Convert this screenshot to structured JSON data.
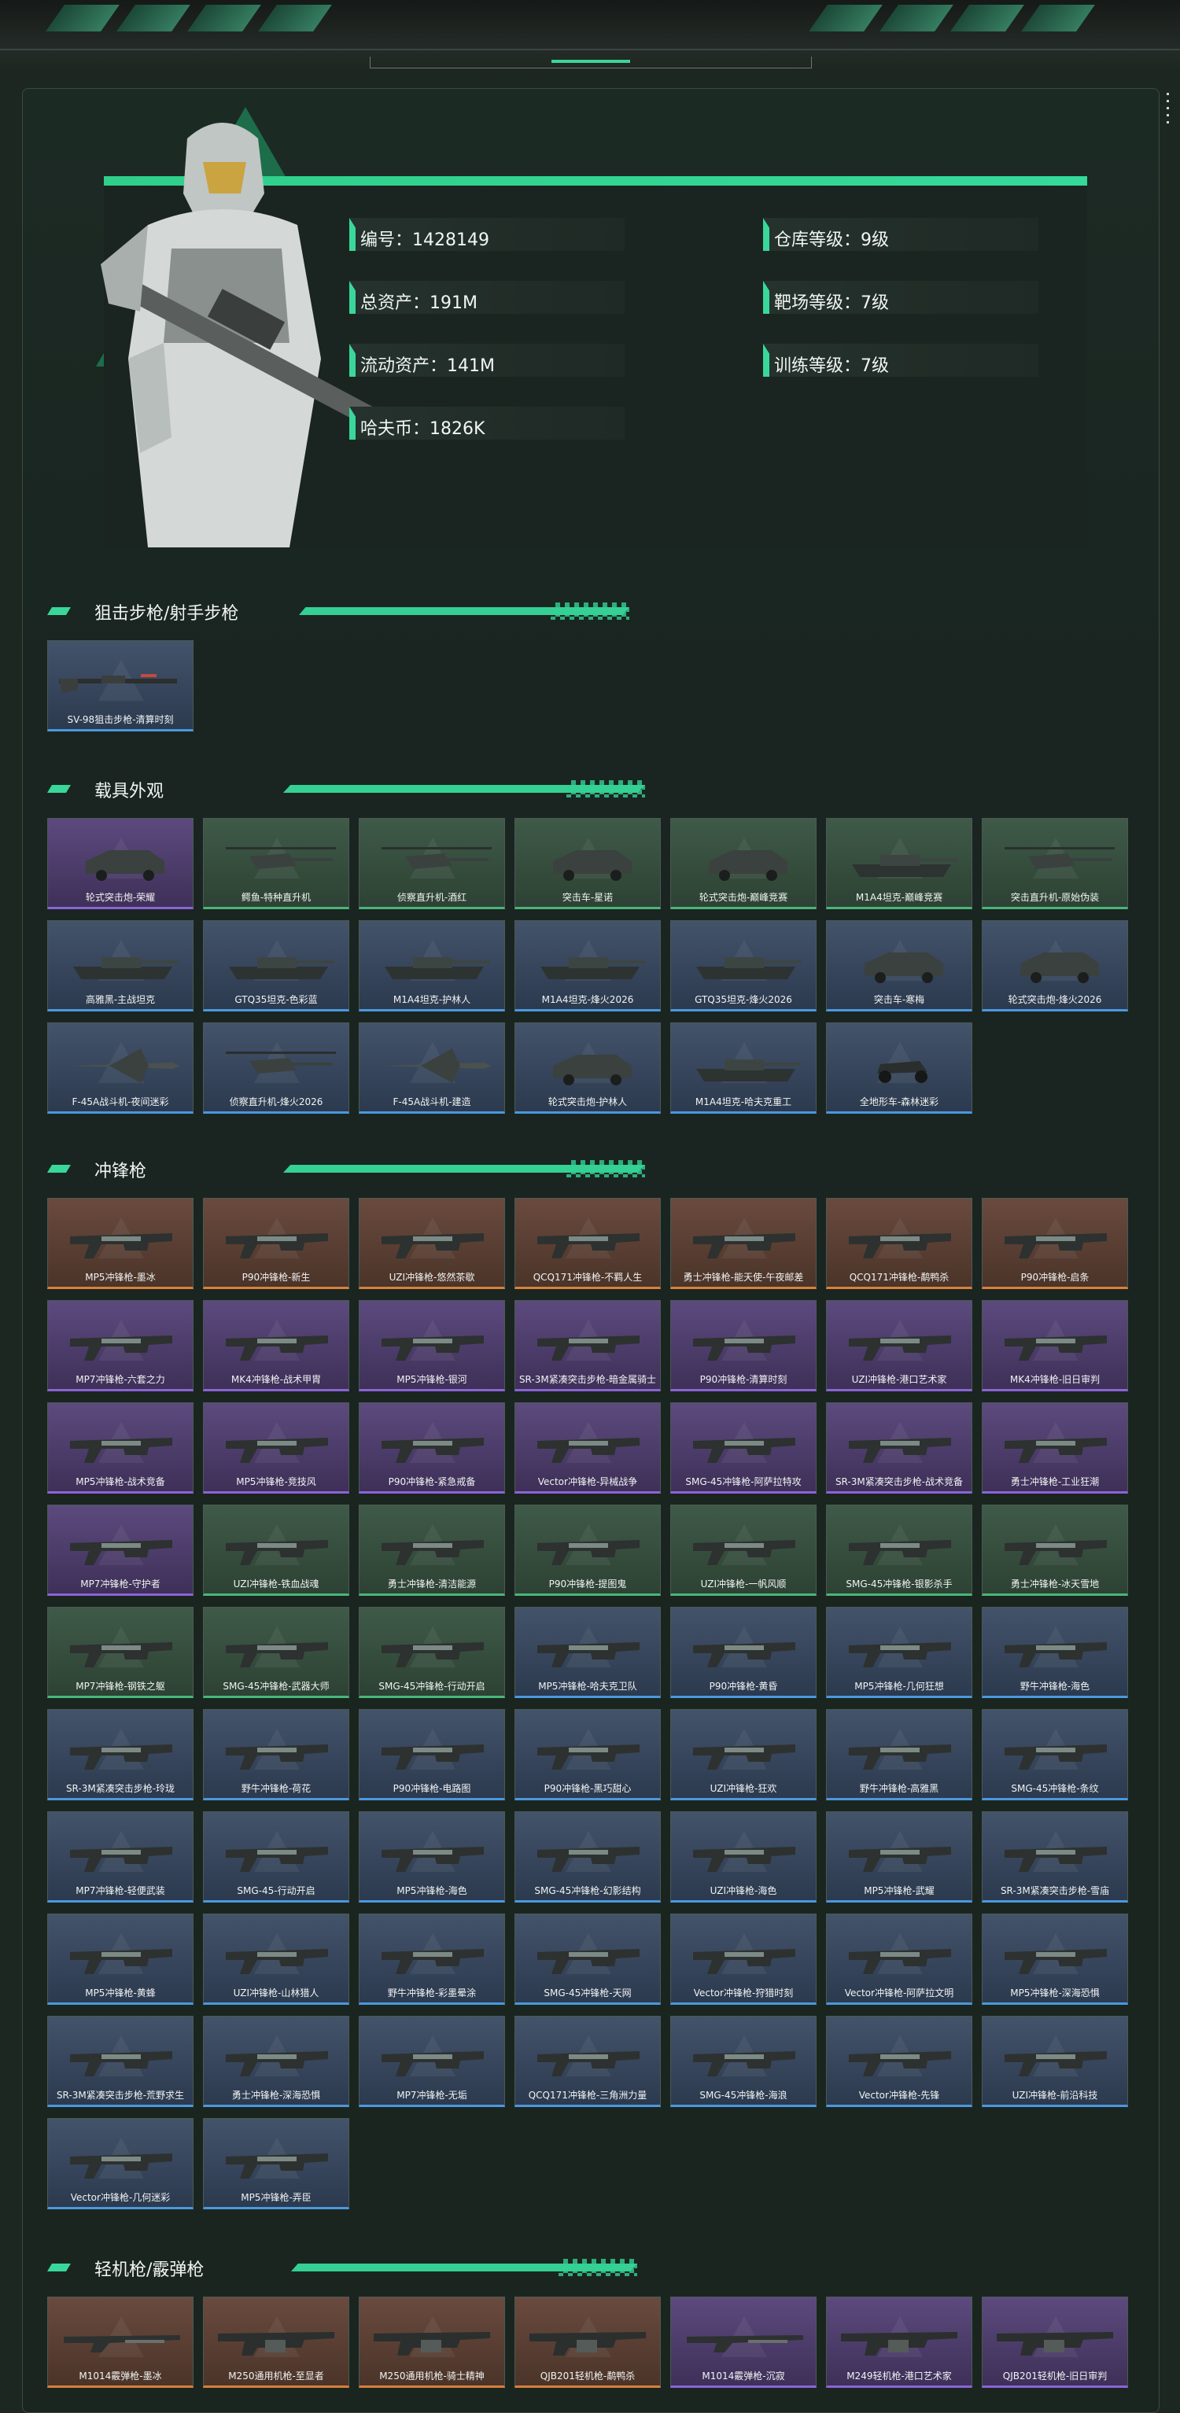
{
  "profile": {
    "stats_left": [
      "编号：1428149",
      "总资产：191M",
      "流动资产：141M",
      "哈夫币：1826K"
    ],
    "stats_right": [
      "仓库等级：9级",
      "靶场等级：7级",
      "训练等级：7级"
    ]
  },
  "sections": [
    {
      "title": "狙击步枪/射手步枪",
      "items": [
        {
          "label": "SV-98狙击步枪-清算时刻",
          "rarity": "blue",
          "icon": "rifle-icon"
        }
      ]
    },
    {
      "title": "载具外观",
      "items": [
        {
          "label": "轮式突击炮-荣耀",
          "rarity": "purple",
          "icon": "vehicle-icon"
        },
        {
          "label": "鳄鱼-特种直升机",
          "rarity": "green",
          "icon": "helicopter-icon"
        },
        {
          "label": "侦察直升机-酒红",
          "rarity": "green",
          "icon": "helicopter-icon"
        },
        {
          "label": "突击车-星诺",
          "rarity": "green",
          "icon": "vehicle-icon"
        },
        {
          "label": "轮式突击炮-巅峰竞赛",
          "rarity": "green",
          "icon": "vehicle-icon"
        },
        {
          "label": "M1A4坦克-巅峰竞赛",
          "rarity": "green",
          "icon": "tank-icon"
        },
        {
          "label": "突击直升机-原始伪装",
          "rarity": "green",
          "icon": "helicopter-icon"
        },
        {
          "label": "高雅黑-主战坦克",
          "rarity": "blue",
          "icon": "tank-icon"
        },
        {
          "label": "GTQ35坦克-色彩蓝",
          "rarity": "blue",
          "icon": "tank-icon"
        },
        {
          "label": "M1A4坦克-护林人",
          "rarity": "blue",
          "icon": "tank-icon"
        },
        {
          "label": "M1A4坦克-烽火2026",
          "rarity": "blue",
          "icon": "tank-icon"
        },
        {
          "label": "GTQ35坦克-烽火2026",
          "rarity": "blue",
          "icon": "tank-icon"
        },
        {
          "label": "突击车-寒梅",
          "rarity": "blue",
          "icon": "vehicle-icon"
        },
        {
          "label": "轮式突击炮-烽火2026",
          "rarity": "blue",
          "icon": "vehicle-icon"
        },
        {
          "label": "F-45A战斗机-夜间迷彩",
          "rarity": "blue",
          "icon": "jet-icon"
        },
        {
          "label": "侦察直升机-烽火2026",
          "rarity": "blue",
          "icon": "helicopter-icon"
        },
        {
          "label": "F-45A战斗机-建造",
          "rarity": "blue",
          "icon": "jet-icon"
        },
        {
          "label": "轮式突击炮-护林人",
          "rarity": "blue",
          "icon": "vehicle-icon"
        },
        {
          "label": "M1A4坦克-哈夫克重工",
          "rarity": "blue",
          "icon": "tank-icon"
        },
        {
          "label": "全地形车-森林迷彩",
          "rarity": "blue",
          "icon": "atv-icon"
        }
      ]
    },
    {
      "title": "冲锋枪",
      "items": [
        {
          "label": "MP5冲锋枪-墨冰",
          "rarity": "orange",
          "icon": "smg-icon"
        },
        {
          "label": "P90冲锋枪-新生",
          "rarity": "orange",
          "icon": "smg-icon"
        },
        {
          "label": "UZI冲锋枪-悠然茶歇",
          "rarity": "orange",
          "icon": "smg-icon"
        },
        {
          "label": "QCQ171冲锋枪-不羁人生",
          "rarity": "orange",
          "icon": "smg-icon"
        },
        {
          "label": "勇士冲锋枪-能天使-午夜邮差",
          "rarity": "orange",
          "icon": "smg-icon"
        },
        {
          "label": "QCQ171冲锋枪-鹬鸭杀",
          "rarity": "orange",
          "icon": "smg-icon"
        },
        {
          "label": "P90冲锋枪-启条",
          "rarity": "orange",
          "icon": "smg-icon"
        },
        {
          "label": "MP7冲锋枪-六套之力",
          "rarity": "purple",
          "icon": "smg-icon"
        },
        {
          "label": "MK4冲锋枪-战术甲胄",
          "rarity": "purple",
          "icon": "smg-icon"
        },
        {
          "label": "MP5冲锋枪-银河",
          "rarity": "purple",
          "icon": "smg-icon"
        },
        {
          "label": "SR-3M紧凑突击步枪-暗金属骑士",
          "rarity": "purple",
          "icon": "smg-icon"
        },
        {
          "label": "P90冲锋枪-清算时刻",
          "rarity": "purple",
          "icon": "smg-icon"
        },
        {
          "label": "UZI冲锋枪-港口艺术家",
          "rarity": "purple",
          "icon": "smg-icon"
        },
        {
          "label": "MK4冲锋枪-旧日审判",
          "rarity": "purple",
          "icon": "smg-icon"
        },
        {
          "label": "MP5冲锋枪-战术竞备",
          "rarity": "purple",
          "icon": "smg-icon"
        },
        {
          "label": "MP5冲锋枪-竞技风",
          "rarity": "purple",
          "icon": "smg-icon"
        },
        {
          "label": "P90冲锋枪-紧急戒备",
          "rarity": "purple",
          "icon": "smg-icon"
        },
        {
          "label": "Vector冲锋枪-异械战争",
          "rarity": "purple",
          "icon": "smg-icon"
        },
        {
          "label": "SMG-45冲锋枪-阿萨拉特攻",
          "rarity": "purple",
          "icon": "smg-icon"
        },
        {
          "label": "SR-3M紧凑突击步枪-战术竞备",
          "rarity": "purple",
          "icon": "smg-icon"
        },
        {
          "label": "勇士冲锋枪-工业狂潮",
          "rarity": "purple",
          "icon": "smg-icon"
        },
        {
          "label": "MP7冲锋枪-守护者",
          "rarity": "purple",
          "icon": "smg-icon"
        },
        {
          "label": "UZI冲锋枪-铁血战魂",
          "rarity": "green",
          "icon": "smg-icon"
        },
        {
          "label": "勇士冲锋枪-清洁能源",
          "rarity": "green",
          "icon": "smg-icon"
        },
        {
          "label": "P90冲锋枪-提图鬼",
          "rarity": "green",
          "icon": "smg-icon"
        },
        {
          "label": "UZI冲锋枪-一帆风顺",
          "rarity": "green",
          "icon": "smg-icon"
        },
        {
          "label": "SMG-45冲锋枪-银影杀手",
          "rarity": "green",
          "icon": "smg-icon"
        },
        {
          "label": "勇士冲锋枪-冰天雪地",
          "rarity": "green",
          "icon": "smg-icon"
        },
        {
          "label": "MP7冲锋枪-钢铁之躯",
          "rarity": "green",
          "icon": "smg-icon"
        },
        {
          "label": "SMG-45冲锋枪-武器大师",
          "rarity": "green",
          "icon": "smg-icon"
        },
        {
          "label": "SMG-45冲锋枪-行动开启",
          "rarity": "green",
          "icon": "smg-icon"
        },
        {
          "label": "MP5冲锋枪-哈夫克卫队",
          "rarity": "blue",
          "icon": "smg-icon"
        },
        {
          "label": "P90冲锋枪-黄昏",
          "rarity": "blue",
          "icon": "smg-icon"
        },
        {
          "label": "MP5冲锋枪-几何狂想",
          "rarity": "blue",
          "icon": "smg-icon"
        },
        {
          "label": "野牛冲锋枪-海色",
          "rarity": "blue",
          "icon": "smg-icon"
        },
        {
          "label": "SR-3M紧凑突击步枪-玲珑",
          "rarity": "blue",
          "icon": "smg-icon"
        },
        {
          "label": "野牛冲锋枪-荷花",
          "rarity": "blue",
          "icon": "smg-icon"
        },
        {
          "label": "P90冲锋枪-电路图",
          "rarity": "blue",
          "icon": "smg-icon"
        },
        {
          "label": "P90冲锋枪-黑巧甜心",
          "rarity": "blue",
          "icon": "smg-icon"
        },
        {
          "label": "UZI冲锋枪-狂欢",
          "rarity": "blue",
          "icon": "smg-icon"
        },
        {
          "label": "野牛冲锋枪-高雅黑",
          "rarity": "blue",
          "icon": "smg-icon"
        },
        {
          "label": "SMG-45冲锋枪-条纹",
          "rarity": "blue",
          "icon": "smg-icon"
        },
        {
          "label": "MP7冲锋枪-轻便武装",
          "rarity": "blue",
          "icon": "smg-icon"
        },
        {
          "label": "SMG-45-行动开启",
          "rarity": "blue",
          "icon": "smg-icon"
        },
        {
          "label": "MP5冲锋枪-海色",
          "rarity": "blue",
          "icon": "smg-icon"
        },
        {
          "label": "SMG-45冲锋枪-幻影结构",
          "rarity": "blue",
          "icon": "smg-icon"
        },
        {
          "label": "UZI冲锋枪-海色",
          "rarity": "blue",
          "icon": "smg-icon"
        },
        {
          "label": "MP5冲锋枪-武耀",
          "rarity": "blue",
          "icon": "smg-icon"
        },
        {
          "label": "SR-3M紧凑突击步枪-雪庙",
          "rarity": "blue",
          "icon": "smg-icon"
        },
        {
          "label": "MP5冲锋枪-黄蜂",
          "rarity": "blue",
          "icon": "smg-icon"
        },
        {
          "label": "UZI冲锋枪-山林猎人",
          "rarity": "blue",
          "icon": "smg-icon"
        },
        {
          "label": "野牛冲锋枪-彩墨晕涂",
          "rarity": "blue",
          "icon": "smg-icon"
        },
        {
          "label": "SMG-45冲锋枪-天网",
          "rarity": "blue",
          "icon": "smg-icon"
        },
        {
          "label": "Vector冲锋枪-狩猎时刻",
          "rarity": "blue",
          "icon": "smg-icon"
        },
        {
          "label": "Vector冲锋枪-阿萨拉文明",
          "rarity": "blue",
          "icon": "smg-icon"
        },
        {
          "label": "MP5冲锋枪-深海恐惧",
          "rarity": "blue",
          "icon": "smg-icon"
        },
        {
          "label": "SR-3M紧凑突击步枪-荒野求生",
          "rarity": "blue",
          "icon": "smg-icon"
        },
        {
          "label": "勇士冲锋枪-深海恐惧",
          "rarity": "blue",
          "icon": "smg-icon"
        },
        {
          "label": "MP7冲锋枪-无垢",
          "rarity": "blue",
          "icon": "smg-icon"
        },
        {
          "label": "QCQ171冲锋枪-三角洲力量",
          "rarity": "blue",
          "icon": "smg-icon"
        },
        {
          "label": "SMG-45冲锋枪-海浪",
          "rarity": "blue",
          "icon": "smg-icon"
        },
        {
          "label": "Vector冲锋枪-先锋",
          "rarity": "blue",
          "icon": "smg-icon"
        },
        {
          "label": "UZI冲锋枪-前沿科技",
          "rarity": "blue",
          "icon": "smg-icon"
        },
        {
          "label": "Vector冲锋枪-几何迷彩",
          "rarity": "blue",
          "icon": "smg-icon"
        },
        {
          "label": "MP5冲锋枪-弄臣",
          "rarity": "blue",
          "icon": "smg-icon"
        }
      ]
    },
    {
      "title": "轻机枪/霰弹枪",
      "items": [
        {
          "label": "M1014霰弹枪-墨冰",
          "rarity": "orange",
          "icon": "shotgun-icon"
        },
        {
          "label": "M250通用机枪-至显者",
          "rarity": "orange",
          "icon": "lmg-icon"
        },
        {
          "label": "M250通用机枪-骑士精神",
          "rarity": "orange",
          "icon": "lmg-icon"
        },
        {
          "label": "QJB201轻机枪-鹬鸭杀",
          "rarity": "orange",
          "icon": "lmg-icon"
        },
        {
          "label": "M1014霰弹枪-沉寂",
          "rarity": "purple",
          "icon": "shotgun-icon"
        },
        {
          "label": "M249轻机枪-港口艺术家",
          "rarity": "purple",
          "icon": "lmg-icon"
        },
        {
          "label": "QJB201轻机枪-旧日审判",
          "rarity": "purple",
          "icon": "lmg-icon"
        }
      ]
    }
  ],
  "colors": {
    "accent": "#39d89a",
    "orange": "#d7803a",
    "purple": "#8b64d6",
    "green": "#48b679",
    "blue": "#4a98de"
  }
}
